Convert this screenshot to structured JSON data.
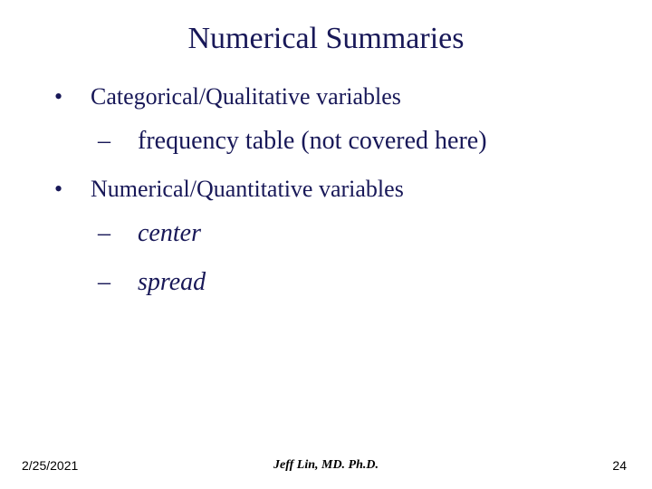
{
  "title": "Numerical Summaries",
  "bullets": [
    {
      "text": "Categorical/Qualitative variables",
      "subs": [
        {
          "text": "frequency table (not covered here)",
          "italic": false
        }
      ]
    },
    {
      "text": "Numerical/Quantitative variables",
      "subs": [
        {
          "text": "center",
          "italic": true
        },
        {
          "text": "spread",
          "italic": true
        }
      ]
    }
  ],
  "footer": {
    "date": "2/25/2021",
    "author": "Jeff Lin, MD. Ph.D.",
    "page": "24"
  }
}
